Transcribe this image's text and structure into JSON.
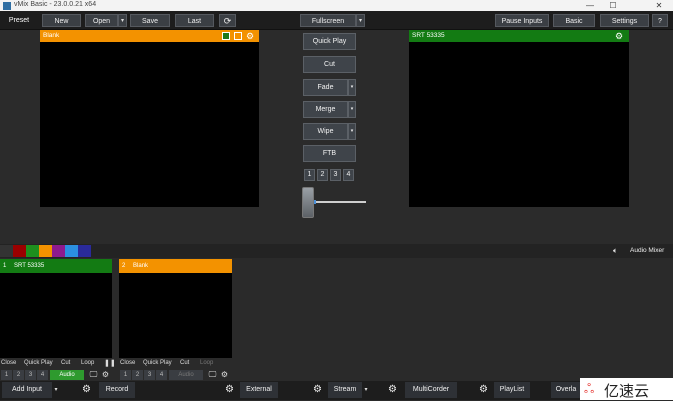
{
  "window": {
    "title": "vMix Basic - 23.0.0.21 x64",
    "controls": [
      "—",
      "☐",
      "✕"
    ]
  },
  "menu": {
    "preset": "Preset",
    "new": "New",
    "open": "Open",
    "save": "Save",
    "last": "Last",
    "fullscreen": "Fullscreen",
    "pause_inputs": "Pause Inputs",
    "basic": "Basic",
    "settings": "Settings",
    "help": "?"
  },
  "preview": {
    "title": "Blank"
  },
  "output": {
    "title": "SRT  53335"
  },
  "transitions": {
    "quick_play": "Quick Play",
    "cut": "Cut",
    "fade": "Fade",
    "merge": "Merge",
    "wipe": "Wipe",
    "ftb": "FTB"
  },
  "transition_numbers": [
    "1",
    "2",
    "3",
    "4"
  ],
  "colors": {
    "orange": "#f39200",
    "green": "#137b13",
    "slider": "#4a90d9"
  },
  "color_swatches": [
    "#9b0000",
    "#1e8f1e",
    "#f39200",
    "#8e1a8e",
    "#2b8fe0",
    "#2a2a9a"
  ],
  "audio_mixer": "Audio Mixer",
  "inputs": [
    {
      "number": "1",
      "name": "SRT  53335",
      "controls": [
        "Close",
        "Quick Play",
        "Cut",
        "Loop"
      ],
      "audio": "Audio",
      "color": "#137b13"
    },
    {
      "number": "2",
      "name": "Blank",
      "controls": [
        "Close",
        "Quick Play",
        "Cut",
        "Loop"
      ],
      "audio": "Audio",
      "color": "#f39200"
    }
  ],
  "input_numbers": [
    "1",
    "2",
    "3",
    "4"
  ],
  "bottom": {
    "add_input": "Add Input",
    "record": "Record",
    "external": "External",
    "stream": "Stream",
    "multicorder": "MultiCorder",
    "playlist": "PlayList",
    "overlay": "Overla"
  },
  "watermark": "亿速云"
}
